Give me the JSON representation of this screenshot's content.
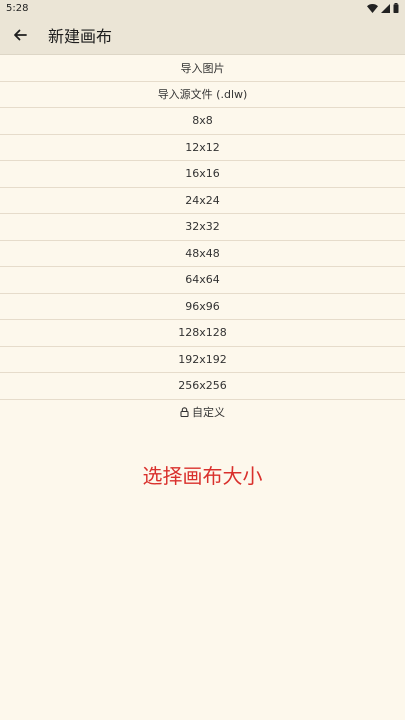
{
  "status_bar": {
    "time": "5:28"
  },
  "app_bar": {
    "title": "新建画布"
  },
  "list": {
    "items": [
      "导入图片",
      "导入源文件 (.dlw)",
      "8x8",
      "12x12",
      "16x16",
      "24x24",
      "32x32",
      "48x48",
      "64x64",
      "96x96",
      "128x128",
      "192x192",
      "256x256",
      "自定义"
    ]
  },
  "prompt": "选择画布大小",
  "colors": {
    "background": "#fdf8ec",
    "app_bar": "#ebe5d6",
    "divider": "#e6dccb",
    "prompt": "#d9302c"
  }
}
